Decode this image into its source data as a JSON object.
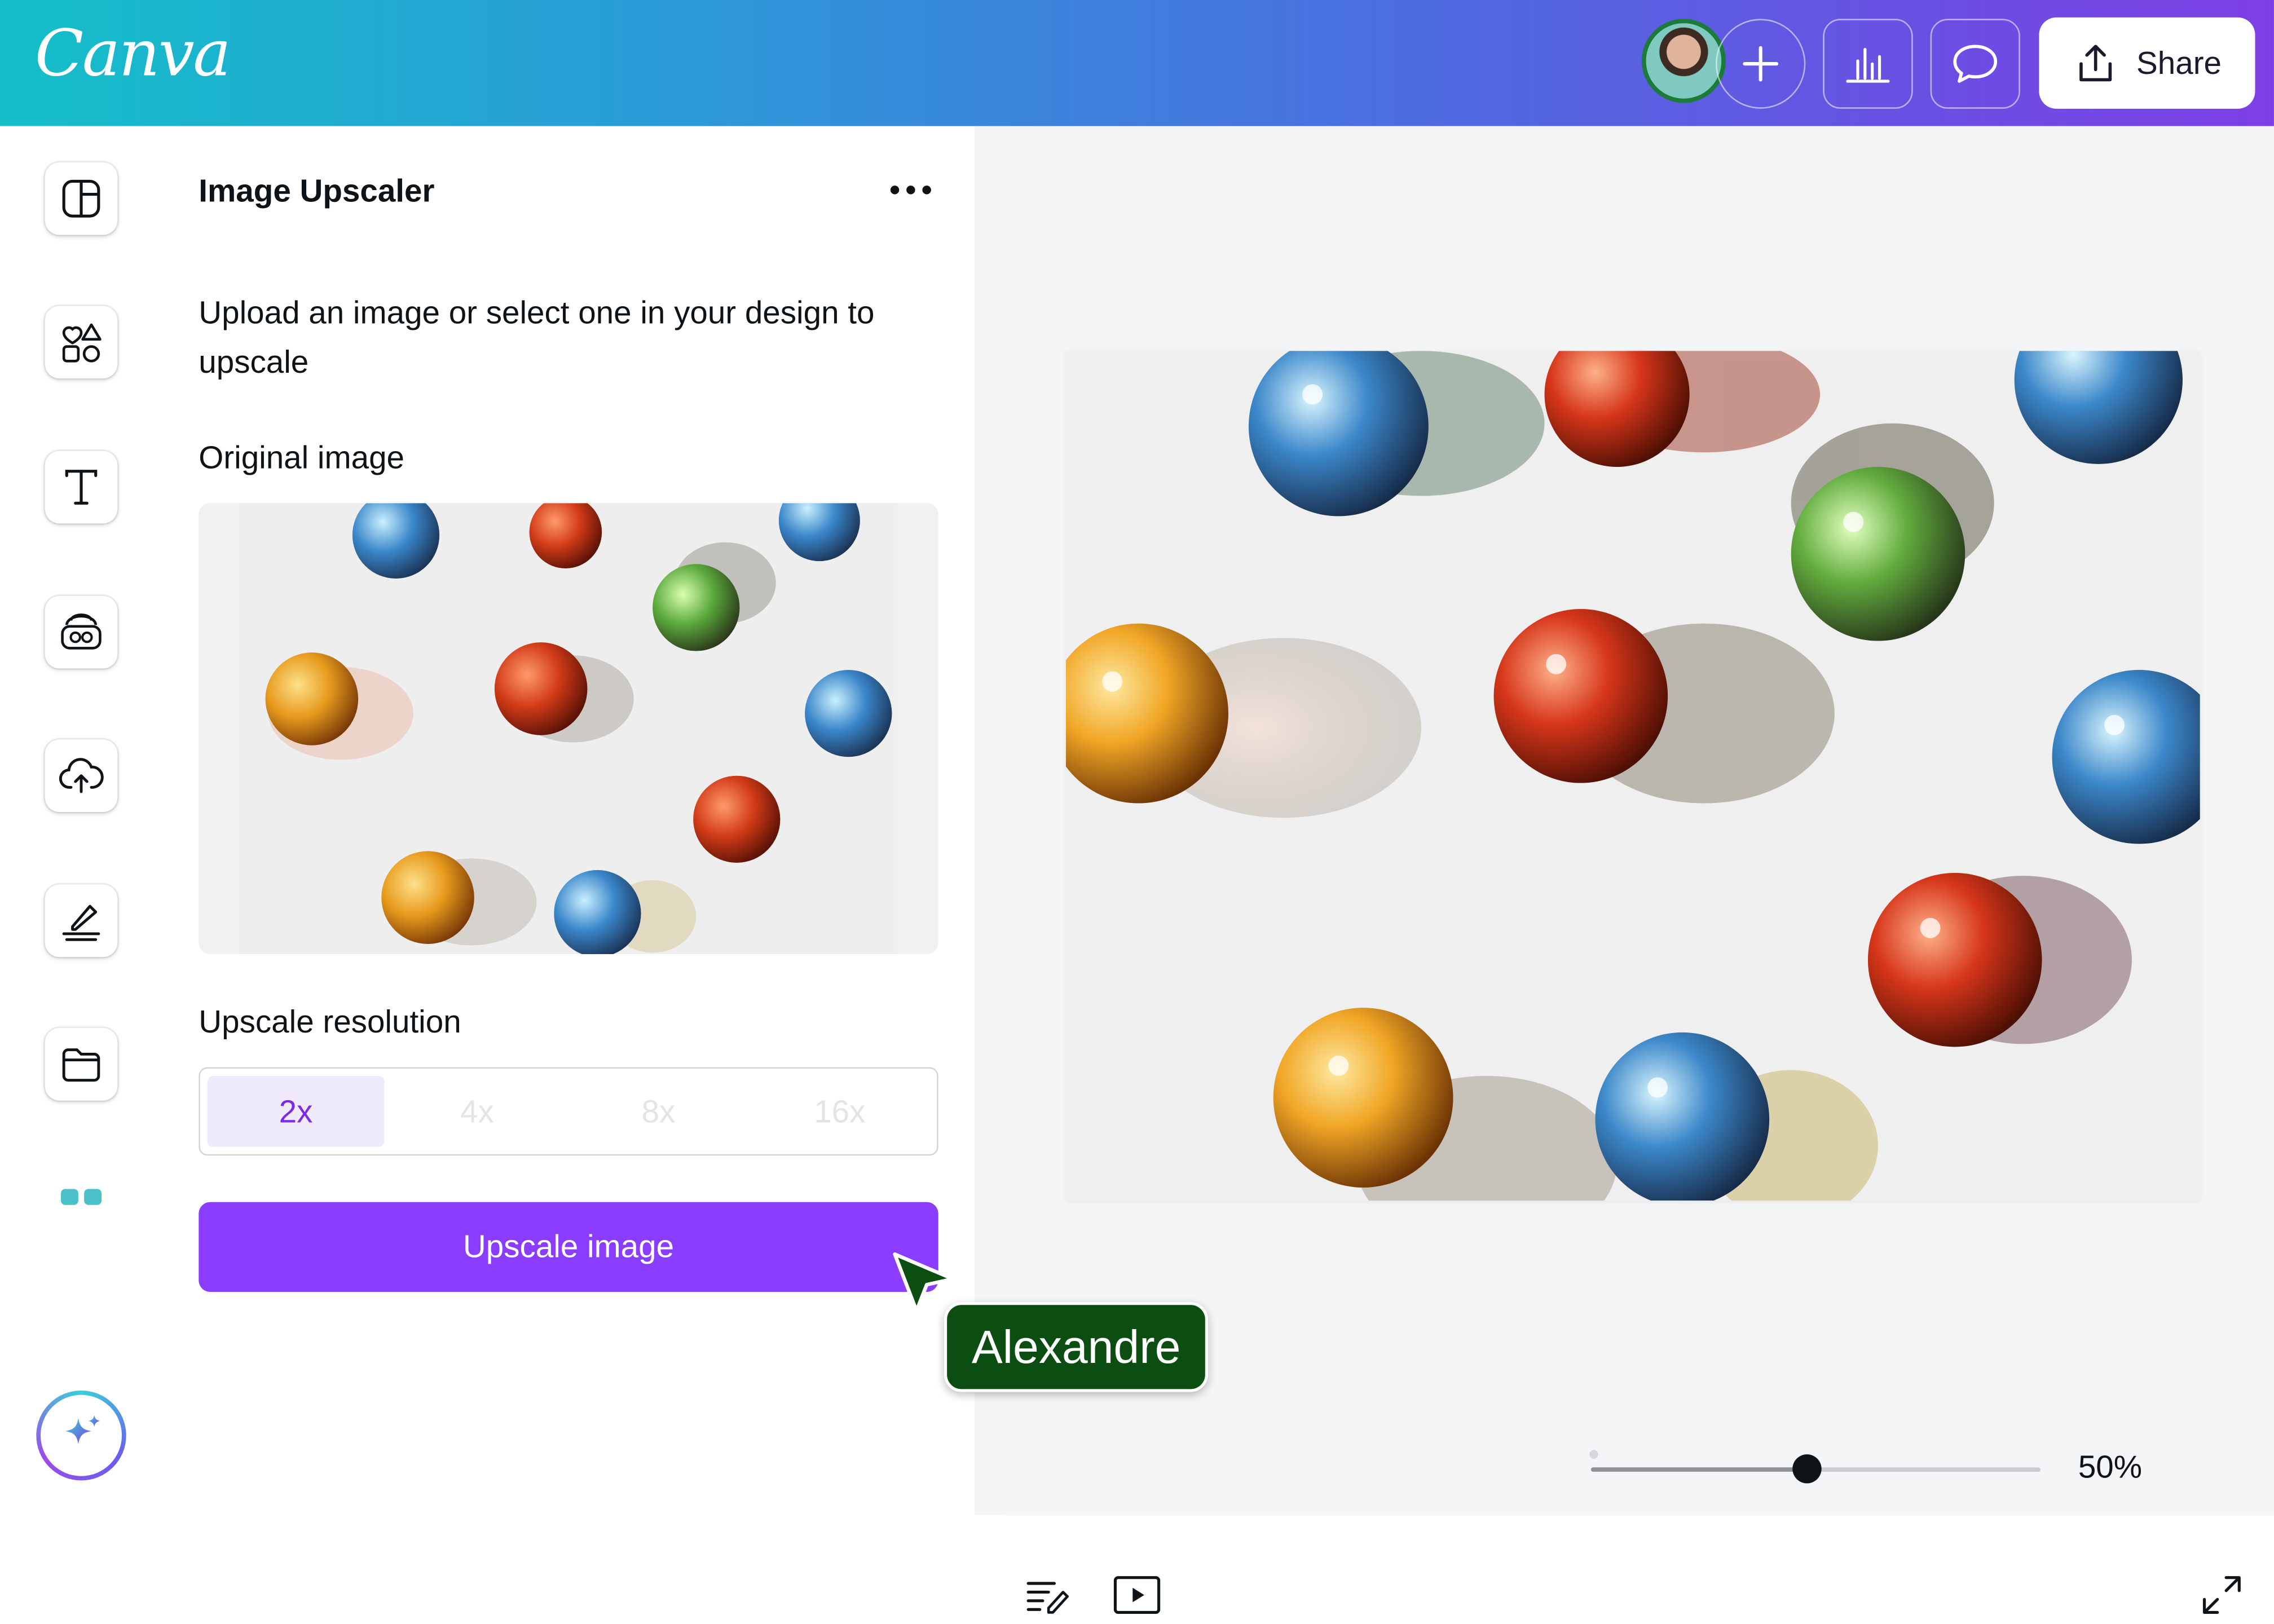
{
  "app": {
    "logo_text": "Canva"
  },
  "header": {
    "share_label": "Share",
    "icons": [
      "user-avatar",
      "plus-icon",
      "insights-icon",
      "comment-icon",
      "share-icon"
    ]
  },
  "rail": {
    "items": [
      {
        "icon": "design-layout-icon"
      },
      {
        "icon": "elements-icon"
      },
      {
        "icon": "text-icon"
      },
      {
        "icon": "brand-icon"
      },
      {
        "icon": "uploads-icon"
      },
      {
        "icon": "draw-icon"
      },
      {
        "icon": "projects-icon"
      },
      {
        "icon": "apps-icon"
      }
    ],
    "magic_icon": "magic-sparkle-icon"
  },
  "panel": {
    "title": "Image Upscaler",
    "description": "Upload an image or select one in your design to upscale",
    "original_label": "Original image",
    "resolution_label": "Upscale resolution",
    "resolution_options": [
      "2x",
      "4x",
      "8x",
      "16x"
    ],
    "selected_resolution": "2x",
    "upscale_button": "Upscale image"
  },
  "collaborator": {
    "name": "Alexandre"
  },
  "footer": {
    "zoom_label": "50%",
    "zoom_value": 0.48
  },
  "colors": {
    "accent": "#8b3dff",
    "selected_bg": "#efeafc",
    "collab_tag": "#0c4d12",
    "canvas_bg": "#f4f5f7"
  }
}
